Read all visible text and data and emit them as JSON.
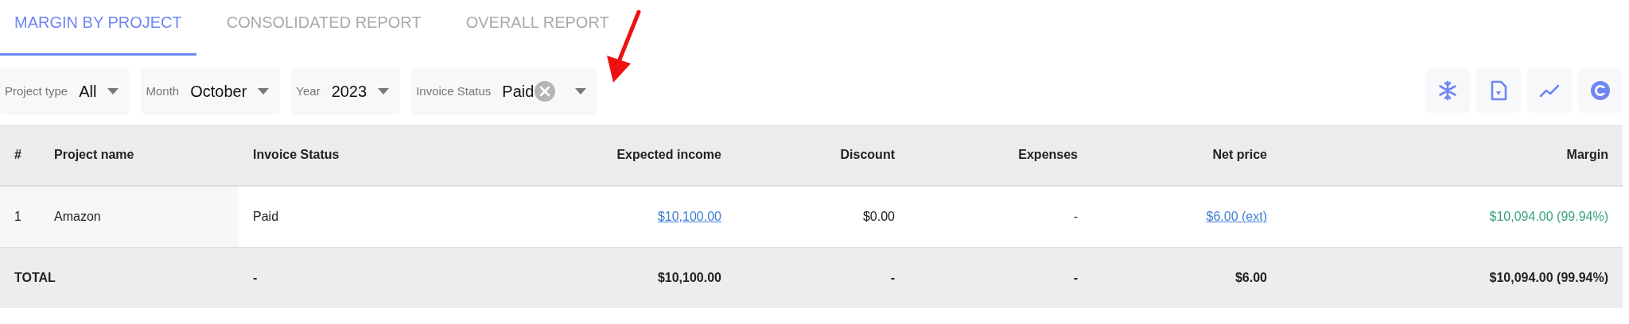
{
  "tabs": [
    {
      "label": "MARGIN BY PROJECT",
      "selected": true
    },
    {
      "label": "CONSOLIDATED REPORT",
      "selected": false
    },
    {
      "label": "OVERALL REPORT",
      "selected": false
    }
  ],
  "filters": [
    {
      "label": "Project type",
      "value": "All",
      "clearable": false
    },
    {
      "label": "Month",
      "value": "October",
      "clearable": false
    },
    {
      "label": "Year",
      "value": "2023",
      "clearable": false
    },
    {
      "label": "Invoice Status",
      "value": "Paid",
      "clearable": true
    }
  ],
  "table": {
    "columns": [
      "#",
      "Project name",
      "Invoice Status",
      "Expected income",
      "Discount",
      "Expenses",
      "Net price",
      "Margin"
    ],
    "rows": [
      [
        {
          "text": "1",
          "kind": "text"
        },
        {
          "text": "Amazon",
          "kind": "text"
        },
        {
          "text": "Paid",
          "kind": "text"
        },
        {
          "text": "$10,100.00",
          "kind": "link"
        },
        {
          "text": "$0.00",
          "kind": "text"
        },
        {
          "text": "-",
          "kind": "text"
        },
        {
          "text": "$6.00 (ext)",
          "kind": "link"
        },
        {
          "text": "$10,094.00 (99.94%)",
          "kind": "positive"
        }
      ]
    ],
    "total": [
      "TOTAL",
      "-",
      "$10,100.00",
      "-",
      "-",
      "$6.00",
      "$10,094.00 (99.94%)"
    ]
  }
}
